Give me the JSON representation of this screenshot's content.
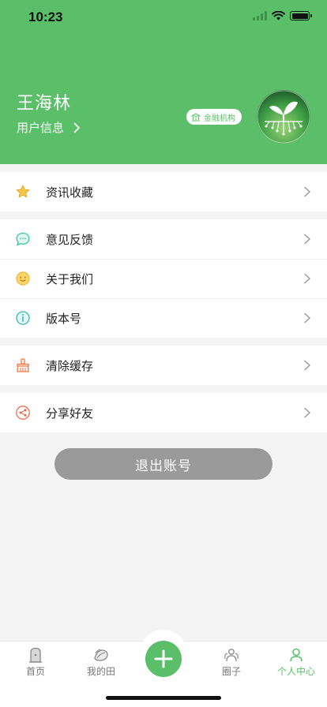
{
  "status_bar": {
    "time": "10:23",
    "icons": [
      "signal-icon",
      "wifi-icon",
      "battery-icon"
    ]
  },
  "profile": {
    "name": "王海林",
    "info_label": "用户信息",
    "badge_label": "金融机构",
    "avatar_icon": "sprout-circuit-logo"
  },
  "menu": {
    "favorites": {
      "label": "资讯收藏",
      "icon": "star-icon"
    },
    "feedback": {
      "label": "意见反馈",
      "icon": "chat-bubble-icon"
    },
    "about": {
      "label": "关于我们",
      "icon": "smiley-icon"
    },
    "version": {
      "label": "版本号",
      "icon": "info-icon"
    },
    "clear_cache": {
      "label": "清除缓存",
      "icon": "broom-icon"
    },
    "share": {
      "label": "分享好友",
      "icon": "share-icon"
    }
  },
  "logout": {
    "label": "退出账号"
  },
  "tabbar": {
    "home": "首页",
    "my_field": "我的田",
    "circle": "圈子",
    "profile": "个人中心"
  },
  "colors": {
    "brand": "#5bbf6a",
    "logout_bg": "#9a9a9a",
    "page_bg": "#f4f4f4"
  }
}
